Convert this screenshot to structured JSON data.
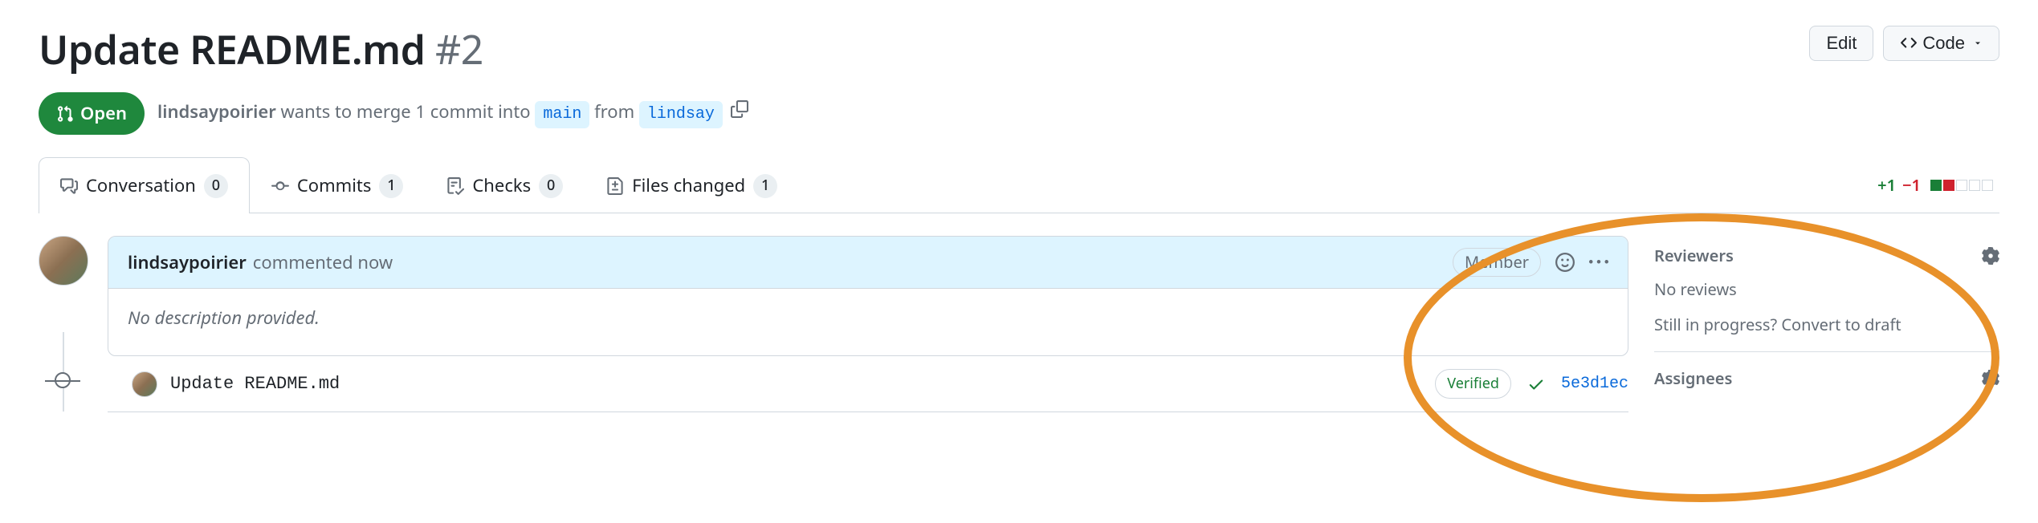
{
  "header": {
    "title_main": "Update README.md",
    "title_number": "#2",
    "edit_label": "Edit",
    "code_label": "Code"
  },
  "state": {
    "pill_label": "Open",
    "author": "lindsaypoirier",
    "merge_prefix": " wants to merge 1 commit into ",
    "base_branch": "main",
    "merge_mid": " from ",
    "head_branch": "lindsay"
  },
  "tabs": {
    "conversation": {
      "label": "Conversation",
      "count": "0"
    },
    "commits": {
      "label": "Commits",
      "count": "1"
    },
    "checks": {
      "label": "Checks",
      "count": "0"
    },
    "files": {
      "label": "Files changed",
      "count": "1"
    }
  },
  "diffstat": {
    "add": "+1",
    "del": "−1"
  },
  "comment": {
    "author": "lindsaypoirier",
    "when": " commented now",
    "role": "Member",
    "body": "No description provided."
  },
  "commit": {
    "message": "Update README.md",
    "verified_label": "Verified",
    "sha": "5e3d1ec"
  },
  "sidebar": {
    "reviewers": {
      "title": "Reviewers",
      "none": "No reviews",
      "draft_prompt": "Still in progress? ",
      "draft_link": "Convert to draft"
    },
    "assignees": {
      "title": "Assignees"
    }
  }
}
